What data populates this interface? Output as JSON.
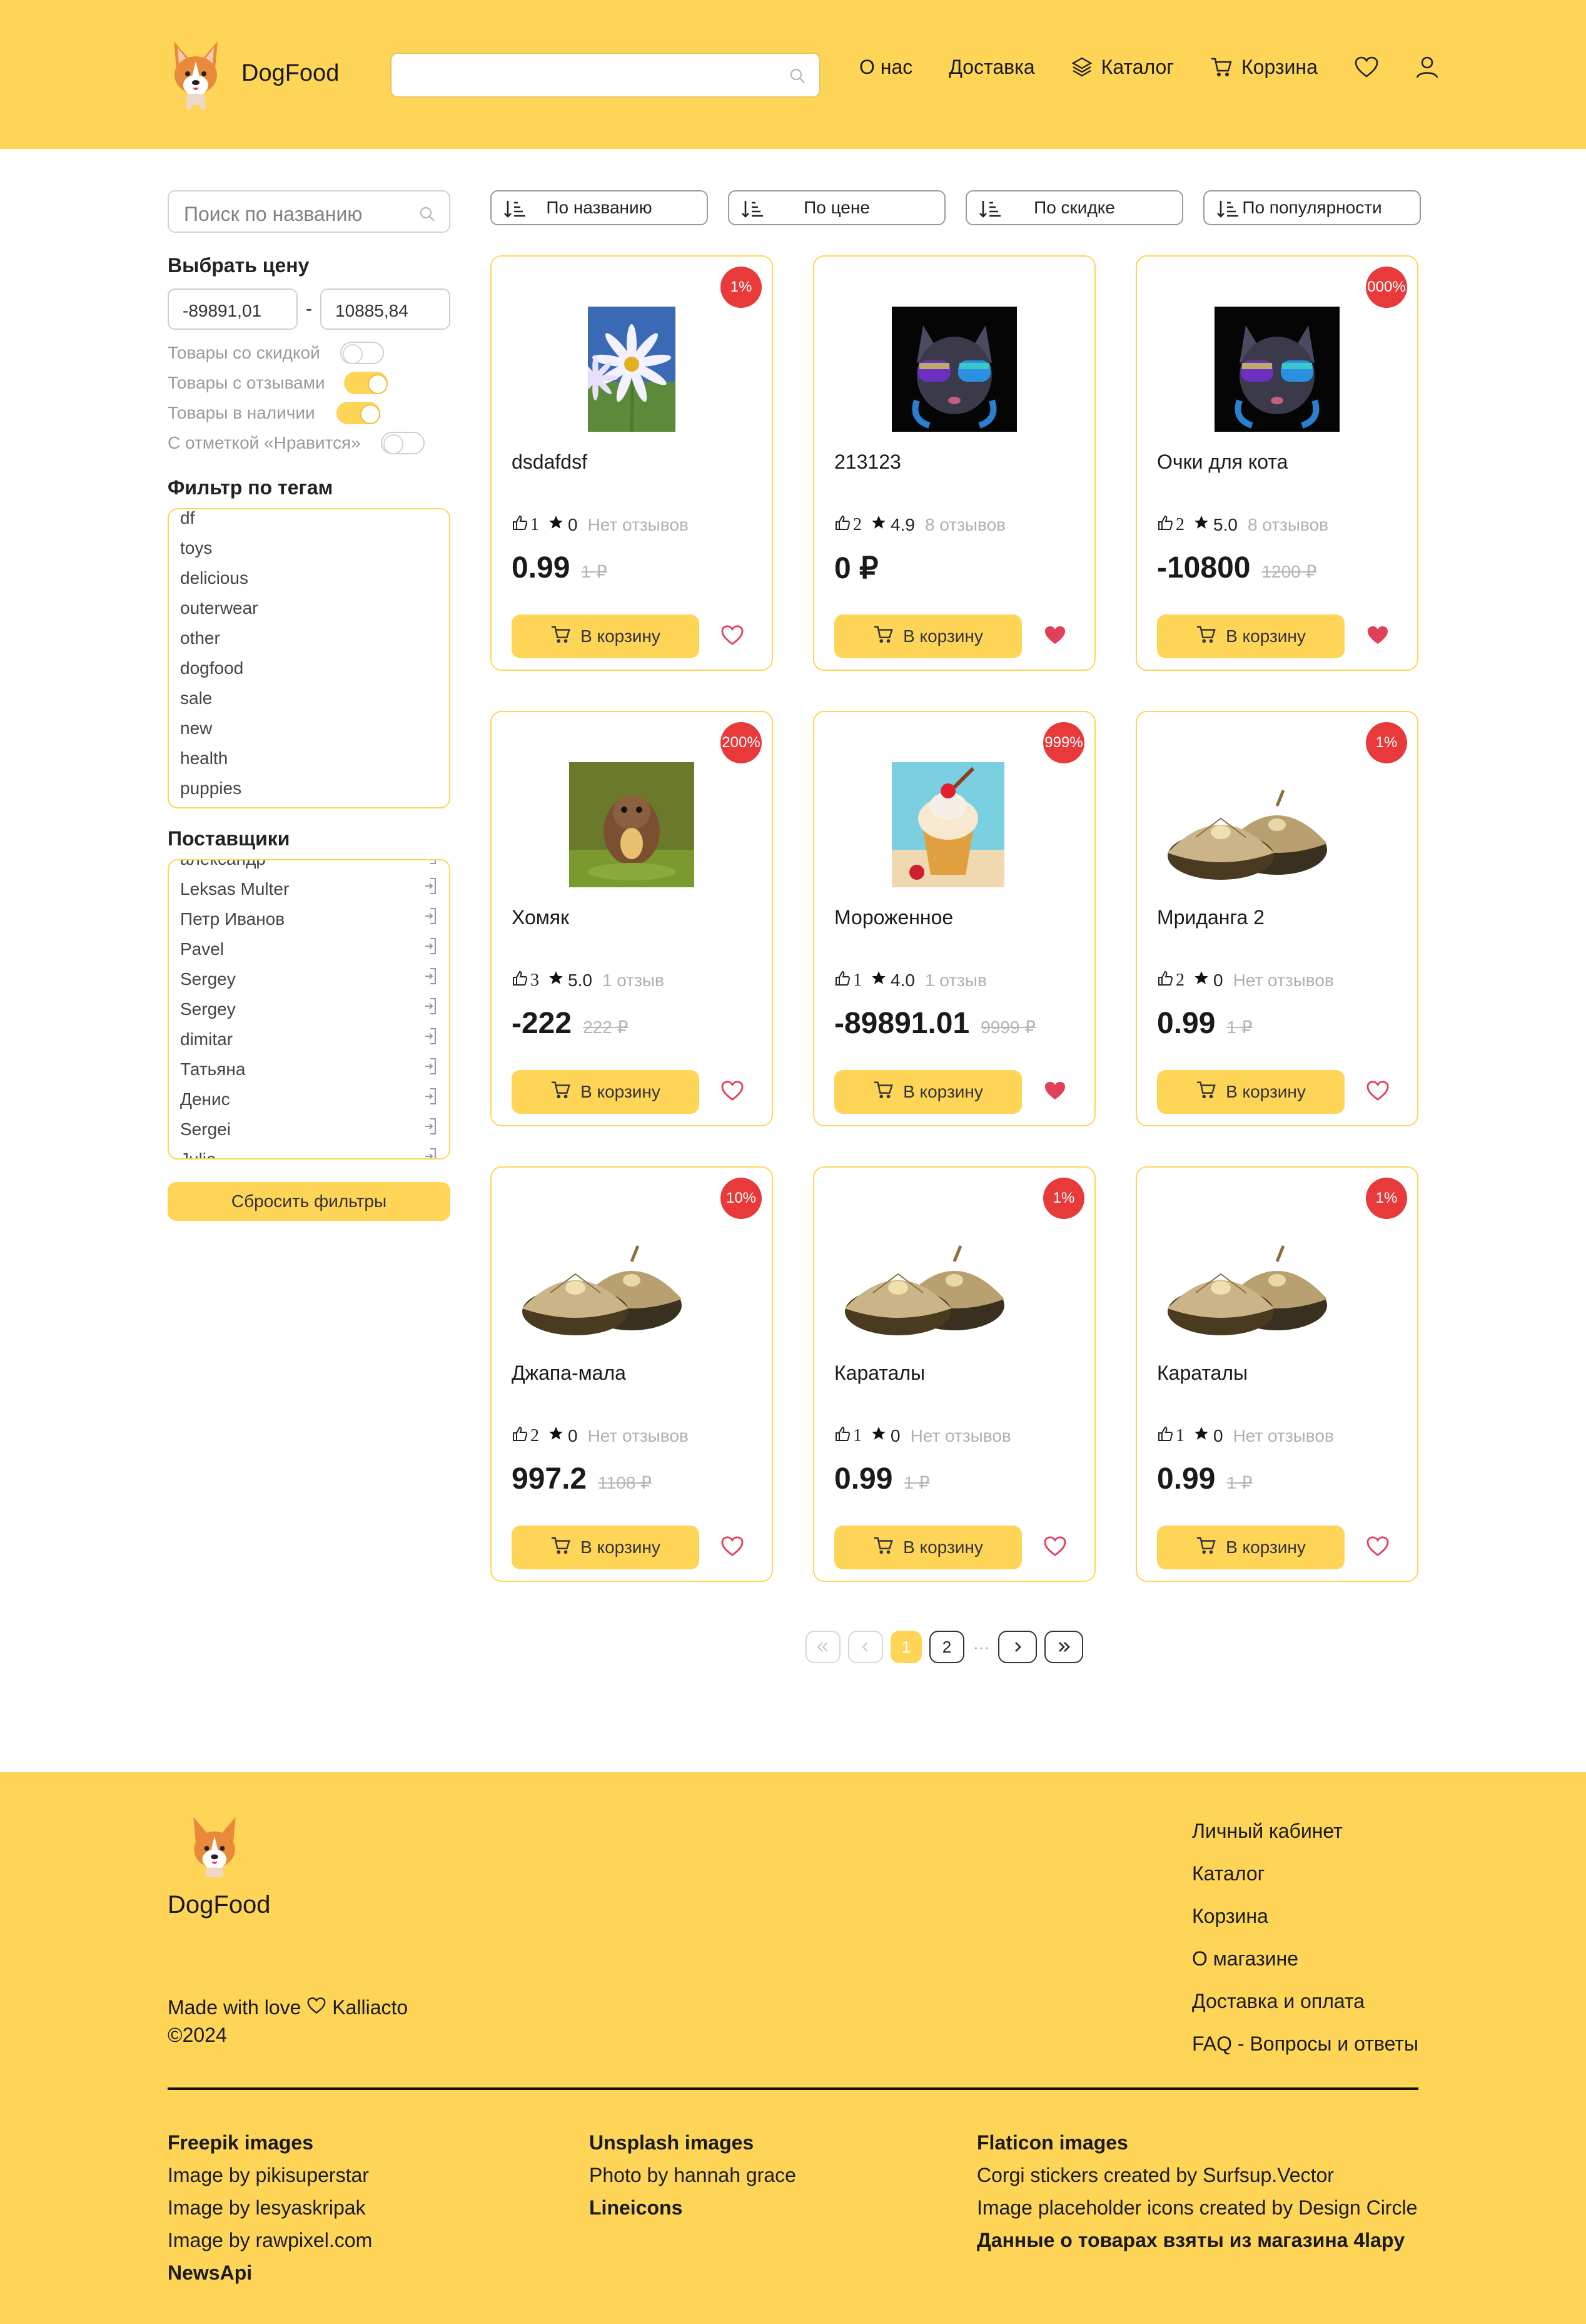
{
  "brand": {
    "name": "DogFood"
  },
  "nav": {
    "about": "О нас",
    "delivery": "Доставка",
    "catalog": "Каталог",
    "cart": "Корзина"
  },
  "search": {
    "top_value": "",
    "side_placeholder": "Поиск по названию"
  },
  "filters": {
    "price_title": "Выбрать цену",
    "price_min": "-89891,01",
    "price_sep": "-",
    "price_max": "10885,84",
    "toggles": [
      {
        "label": "Товары со скидкой",
        "on": false
      },
      {
        "label": "Товары с отзывами",
        "on": true
      },
      {
        "label": "Товары в наличии",
        "on": true
      },
      {
        "label": "С отметкой «Нравится»",
        "on": false
      }
    ],
    "tags_title": "Фильтр по тегам",
    "tags": [
      "df",
      "toys",
      "delicious",
      "outerwear",
      "other",
      "dogfood",
      "sale",
      "new",
      "health",
      "puppies"
    ],
    "suppliers_title": "Поставщики",
    "suppliers_partial_top": "александр",
    "suppliers": [
      "Leksas Multer",
      "Петр Иванов",
      "Pavel",
      "Sergey",
      "Sergey",
      "dimitar",
      "Татьяна",
      "Денис",
      "Sergei"
    ],
    "suppliers_partial_bottom": "Julia",
    "reset": "Сбросить фильтры"
  },
  "sort": [
    "По названию",
    "По цене",
    "По скидке",
    "По популярности"
  ],
  "products": [
    {
      "name": "dsdafdsf",
      "badge": "1%",
      "likes": "1",
      "rating": "0",
      "reviews": "Нет отзывов",
      "price": "0.99",
      "old": "1 ₽",
      "cart": "В корзину",
      "liked": false,
      "img": "flowers"
    },
    {
      "name": "213123",
      "badge": "",
      "likes": "2",
      "rating": "4.9",
      "reviews": "8 отзывов",
      "price": "0 ₽",
      "old": "",
      "cart": "В корзину",
      "liked": true,
      "img": "cat"
    },
    {
      "name": "Очки для кота",
      "badge": "000%",
      "likes": "2",
      "rating": "5.0",
      "reviews": "8 отзывов",
      "price": "-10800",
      "old": "1200 ₽",
      "cart": "В корзину",
      "liked": true,
      "img": "cat"
    },
    {
      "name": "Хомяк",
      "badge": "200%",
      "likes": "3",
      "rating": "5.0",
      "reviews": "1 отзыв",
      "price": "-222",
      "old": "222 ₽",
      "cart": "В корзину",
      "liked": false,
      "img": "hamster"
    },
    {
      "name": "Мороженное",
      "badge": "999%",
      "likes": "1",
      "rating": "4.0",
      "reviews": "1 отзыв",
      "price": "-89891.01",
      "old": "9999 ₽",
      "cart": "В корзину",
      "liked": true,
      "img": "icecream"
    },
    {
      "name": "Мриданга 2",
      "badge": "1%",
      "likes": "2",
      "rating": "0",
      "reviews": "Нет отзывов",
      "price": "0.99",
      "old": "1 ₽",
      "cart": "В корзину",
      "liked": false,
      "img": "cymbals"
    },
    {
      "name": "Джапа-мала",
      "badge": "10%",
      "likes": "2",
      "rating": "0",
      "reviews": "Нет отзывов",
      "price": "997.2",
      "old": "1108 ₽",
      "cart": "В корзину",
      "liked": false,
      "img": "cymbals"
    },
    {
      "name": "Караталы",
      "badge": "1%",
      "likes": "1",
      "rating": "0",
      "reviews": "Нет отзывов",
      "price": "0.99",
      "old": "1 ₽",
      "cart": "В корзину",
      "liked": false,
      "img": "cymbals"
    },
    {
      "name": "Караталы",
      "badge": "1%",
      "likes": "1",
      "rating": "0",
      "reviews": "Нет отзывов",
      "price": "0.99",
      "old": "1 ₽",
      "cart": "В корзину",
      "liked": false,
      "img": "cymbals"
    }
  ],
  "pagination": {
    "pages": [
      "1",
      "2"
    ],
    "current": "1",
    "dots": "···"
  },
  "footer": {
    "brand": "DogFood",
    "made_prefix": "Made with love",
    "made_author": "Kalliacto",
    "year": "©2024",
    "links": [
      "Личный кабинет",
      "Каталог",
      "Корзина",
      "О магазине",
      "Доставка и оплата",
      "FAQ - Вопросы и ответы"
    ],
    "col1": [
      {
        "t": "Freepik images",
        "b": true
      },
      {
        "t": "Image by pikisuperstar",
        "b": false
      },
      {
        "t": "Image by lesyaskripak",
        "b": false
      },
      {
        "t": "Image by rawpixel.com",
        "b": false
      },
      {
        "t": "NewsApi",
        "b": true
      }
    ],
    "col2": [
      {
        "t": "Unsplash images",
        "b": true
      },
      {
        "t": "Photo by hannah grace",
        "b": false
      },
      {
        "t": "Lineicons",
        "b": true
      }
    ],
    "col3": [
      {
        "t": "Flaticon images",
        "b": true
      },
      {
        "t": "Corgi stickers created by Surfsup.Vector",
        "b": false
      },
      {
        "t": "Image placeholder icons created by Design Circle",
        "b": false
      },
      {
        "t": "Данные о товарах взяты из магазина 4lapy",
        "b": true
      }
    ]
  },
  "colors": {
    "brand": "#ffd558",
    "badge": "#e83a3a",
    "heart": "#e0405a"
  }
}
